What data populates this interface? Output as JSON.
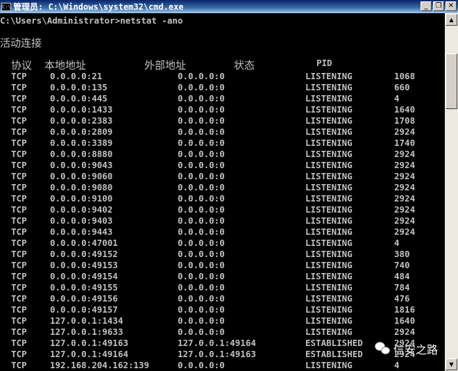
{
  "window": {
    "title": "管理员: C:\\Windows\\system32\\cmd.exe",
    "icon": "cmd-icon",
    "buttons": [
      "minimize",
      "maximize",
      "close"
    ]
  },
  "console": {
    "prompt": "C:\\Users\\Administrator>netstat -ano",
    "section_title": "活动连接",
    "headers": [
      "协议",
      "本地地址",
      "外部地址",
      "状态",
      "PID"
    ],
    "rows": [
      [
        "TCP",
        "0.0.0.0:21",
        "0.0.0.0:0",
        "LISTENING",
        "1068"
      ],
      [
        "TCP",
        "0.0.0.0:135",
        "0.0.0.0:0",
        "LISTENING",
        "660"
      ],
      [
        "TCP",
        "0.0.0.0:445",
        "0.0.0.0:0",
        "LISTENING",
        "4"
      ],
      [
        "TCP",
        "0.0.0.0:1433",
        "0.0.0.0:0",
        "LISTENING",
        "1640"
      ],
      [
        "TCP",
        "0.0.0.0:2383",
        "0.0.0.0:0",
        "LISTENING",
        "1708"
      ],
      [
        "TCP",
        "0.0.0.0:2809",
        "0.0.0.0:0",
        "LISTENING",
        "2924"
      ],
      [
        "TCP",
        "0.0.0.0:3389",
        "0.0.0.0:0",
        "LISTENING",
        "1740"
      ],
      [
        "TCP",
        "0.0.0.0:8880",
        "0.0.0.0:0",
        "LISTENING",
        "2924"
      ],
      [
        "TCP",
        "0.0.0.0:9043",
        "0.0.0.0:0",
        "LISTENING",
        "2924"
      ],
      [
        "TCP",
        "0.0.0.0:9060",
        "0.0.0.0:0",
        "LISTENING",
        "2924"
      ],
      [
        "TCP",
        "0.0.0.0:9080",
        "0.0.0.0:0",
        "LISTENING",
        "2924"
      ],
      [
        "TCP",
        "0.0.0.0:9100",
        "0.0.0.0:0",
        "LISTENING",
        "2924"
      ],
      [
        "TCP",
        "0.0.0.0:9402",
        "0.0.0.0:0",
        "LISTENING",
        "2924"
      ],
      [
        "TCP",
        "0.0.0.0:9403",
        "0.0.0.0:0",
        "LISTENING",
        "2924"
      ],
      [
        "TCP",
        "0.0.0.0:9443",
        "0.0.0.0:0",
        "LISTENING",
        "2924"
      ],
      [
        "TCP",
        "0.0.0.0:47001",
        "0.0.0.0:0",
        "LISTENING",
        "4"
      ],
      [
        "TCP",
        "0.0.0.0:49152",
        "0.0.0.0:0",
        "LISTENING",
        "380"
      ],
      [
        "TCP",
        "0.0.0.0:49153",
        "0.0.0.0:0",
        "LISTENING",
        "740"
      ],
      [
        "TCP",
        "0.0.0.0:49154",
        "0.0.0.0:0",
        "LISTENING",
        "484"
      ],
      [
        "TCP",
        "0.0.0.0:49155",
        "0.0.0.0:0",
        "LISTENING",
        "784"
      ],
      [
        "TCP",
        "0.0.0.0:49156",
        "0.0.0.0:0",
        "LISTENING",
        "476"
      ],
      [
        "TCP",
        "0.0.0.0:49157",
        "0.0.0.0:0",
        "LISTENING",
        "1816"
      ],
      [
        "TCP",
        "127.0.0.1:1434",
        "0.0.0.0:0",
        "LISTENING",
        "1640"
      ],
      [
        "TCP",
        "127.0.0.1:9633",
        "0.0.0.0:0",
        "LISTENING",
        "2924"
      ],
      [
        "TCP",
        "127.0.0.1:49163",
        "127.0.0.1:49164",
        "ESTABLISHED",
        "2924"
      ],
      [
        "TCP",
        "127.0.0.1:49164",
        "127.0.0.1:49163",
        "ESTABLISHED",
        "2924"
      ],
      [
        "TCP",
        "192.168.204.162:139",
        "0.0.0.0:0",
        "LISTENING",
        "4"
      ]
    ]
  },
  "watermark": {
    "text": "信安之路",
    "icon": "wechat-icon"
  }
}
